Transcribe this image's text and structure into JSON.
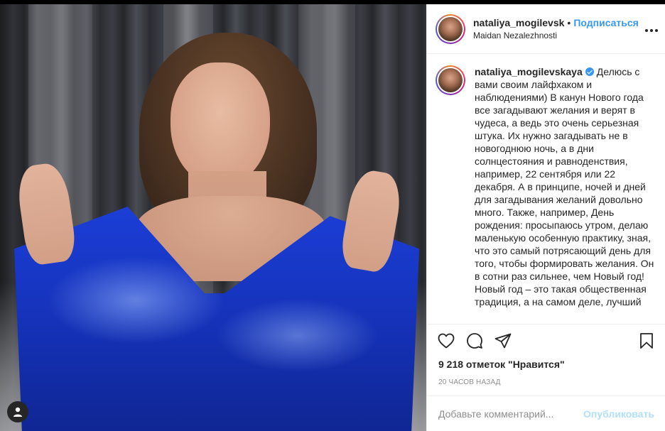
{
  "post": {
    "username": "nataliya_mogilevsk",
    "username_full": "nataliya_mogilevskaya",
    "separator": "•",
    "follow_label": "Подписаться",
    "location": "Maidan Nezalezhnosti",
    "more_label": "•••",
    "caption": "Делюсь с вами своим лайфхаком и наблюдениями) В канун Нового года все загадывают желания и верят в чудеса, а ведь это очень серьезная штука. Их нужно загадывать не в новогоднюю ночь, а в дни солнцестояния и равноденствия, например, 22 сентября или 22 декабря. А в принципе, ночей и дней для загадывания желаний довольно много. Также, например, День рождения: просыпаюсь утром, делаю маленькую особенную практику, зная, что это самый потрясающий день для того, чтобы формировать желания. Он в сотни раз сильнее, чем Новый год! Новый год – это такая общественная традиция, а на самом деле, лучший",
    "likes_text": "9 218 отметок \"Нравится\"",
    "time_ago": "20 часов назад",
    "comment_placeholder": "Добавьте комментарий...",
    "publish_label": "Опубликовать"
  },
  "icons": {
    "like": "heart-icon",
    "comment": "comment-icon",
    "share": "share-icon",
    "save": "bookmark-icon",
    "verified": "verified-badge-icon",
    "user": "user-icon"
  },
  "colors": {
    "link_blue": "#3897f0",
    "publish_disabled": "#b2dffc",
    "muted_text": "#8e8e8e",
    "coat_blue": "#1a3ad0"
  }
}
